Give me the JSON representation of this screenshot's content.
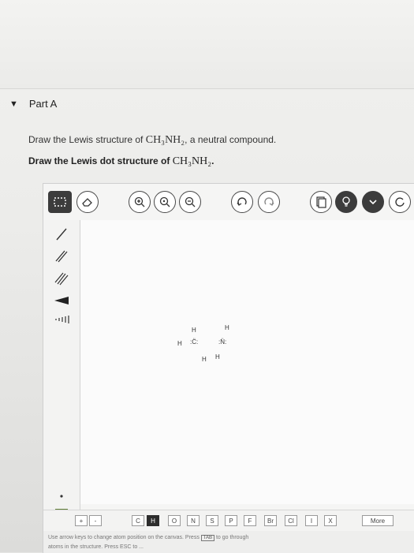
{
  "part": {
    "title": "Part A"
  },
  "question": {
    "prompt_before": "Draw the Lewis structure of ",
    "prompt_formula": "CH₃NH₂",
    "prompt_after": ", a neutral compound.",
    "instruction_before": "Draw the Lewis dot structure of ",
    "instruction_formula": "CH₃NH₂",
    "instruction_after": "."
  },
  "toolbar_icons": [
    "select-marquee-icon",
    "eraser-icon",
    "zoom-in-icon",
    "zoom-reset-icon",
    "zoom-out-icon",
    "undo-icon",
    "redo-icon",
    "templates-icon",
    "hint-icon",
    "expand-icon",
    "reset-icon"
  ],
  "left_tools": [
    "single-bond-icon",
    "double-bond-icon",
    "triple-bond-icon",
    "wedge-bond-icon",
    "hash-bond-icon",
    "lone-pair-icon",
    "radical-icon",
    "bracket-icon"
  ],
  "drawing": {
    "atoms": [
      {
        "symbol": "H"
      },
      {
        "symbol": "H"
      },
      {
        "symbol": "H"
      },
      {
        "symbol": ":C̈:"
      },
      {
        "symbol": ":N̈:"
      },
      {
        "symbol": "H"
      },
      {
        "symbol": "H"
      }
    ]
  },
  "element_bar": {
    "charge_buttons": [
      "+",
      "-"
    ],
    "elements": [
      "C",
      "H",
      "O",
      "N",
      "S",
      "P",
      "F",
      "Br",
      "Cl",
      "I",
      "X"
    ],
    "selected": "H",
    "more_label": "More"
  },
  "hint": {
    "line1_a": "Use arrow keys to change atom position on the canvas. Press",
    "tab_key": "TAB",
    "line1_b": "to go through",
    "line2": "atoms in the structure. Press ESC to ..."
  }
}
